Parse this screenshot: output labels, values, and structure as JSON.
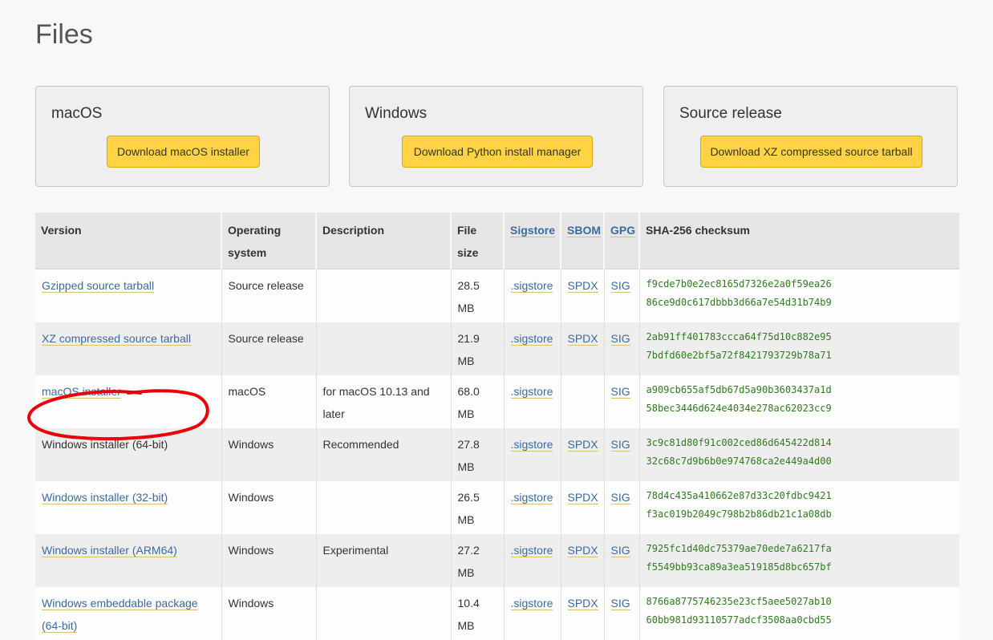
{
  "page_title": "Files",
  "cards": [
    {
      "title": "macOS",
      "button": "Download macOS installer"
    },
    {
      "title": "Windows",
      "button": "Download Python install manager"
    },
    {
      "title": "Source release",
      "button": "Download XZ compressed source tarball"
    }
  ],
  "table": {
    "headers": {
      "version": "Version",
      "os": "Operating system",
      "description": "Description",
      "size": "File size",
      "sigstore": "Sigstore",
      "sbom": "SBOM",
      "gpg": "GPG",
      "sha": "SHA-256 checksum"
    },
    "rows": [
      {
        "version": "Gzipped source tarball",
        "os": "Source release",
        "description": "",
        "size": "28.5 MB",
        "sigstore": ".sigstore",
        "sbom": "SPDX",
        "gpg": "SIG",
        "sha1": "f9cde7b0e2ec8165d7326e2a0f59ea26",
        "sha2": "86ce9d0c617dbbb3d66a7e54d31b74b9"
      },
      {
        "version": "XZ compressed source tarball",
        "os": "Source release",
        "description": "",
        "size": "21.9 MB",
        "sigstore": ".sigstore",
        "sbom": "SPDX",
        "gpg": "SIG",
        "sha1": "2ab91ff401783ccca64f75d10c882e95",
        "sha2": "7bdfd60e2bf5a72f8421793729b78a71"
      },
      {
        "version": "macOS installer",
        "os": "macOS",
        "description": "for macOS 10.13 and later",
        "size": "68.0 MB",
        "sigstore": ".sigstore",
        "sbom": "",
        "gpg": "SIG",
        "sha1": "a909cb655af5db67d5a90b3603437a1d",
        "sha2": "58bec3446d624e4034e278ac62023cc9"
      },
      {
        "version": "Windows installer (64-bit)",
        "os": "Windows",
        "description": "Recommended",
        "size": "27.8 MB",
        "sigstore": ".sigstore",
        "sbom": "SPDX",
        "gpg": "SIG",
        "sha1": "3c9c81d80f91c002ced86d645422d814",
        "sha2": "32c68c7d9b6b0e974768ca2e449a4d00"
      },
      {
        "version": "Windows installer (32-bit)",
        "os": "Windows",
        "description": "",
        "size": "26.5 MB",
        "sigstore": ".sigstore",
        "sbom": "SPDX",
        "gpg": "SIG",
        "sha1": "78d4c435a410662e87d33c20fdbc9421",
        "sha2": "f3ac019b2049c798b2b86db21c1a08db"
      },
      {
        "version": "Windows installer (ARM64)",
        "os": "Windows",
        "description": "Experimental",
        "size": "27.2 MB",
        "sigstore": ".sigstore",
        "sbom": "SPDX",
        "gpg": "SIG",
        "sha1": "7925fc1d40dc75379ae70ede7a6217fa",
        "sha2": "f5549bb93ca89a3ea519185d8bc657bf"
      },
      {
        "version": "Windows embeddable package (64-bit)",
        "os": "Windows",
        "description": "",
        "size": "10.4 MB",
        "sigstore": ".sigstore",
        "sbom": "SPDX",
        "gpg": "SIG",
        "sha1": "8766a8775746235e23cf5aee5027ab10",
        "sha2": "60bb981d93110577adcf3508aa0cbd55"
      }
    ]
  },
  "annotation": {
    "color": "#e8000b"
  }
}
